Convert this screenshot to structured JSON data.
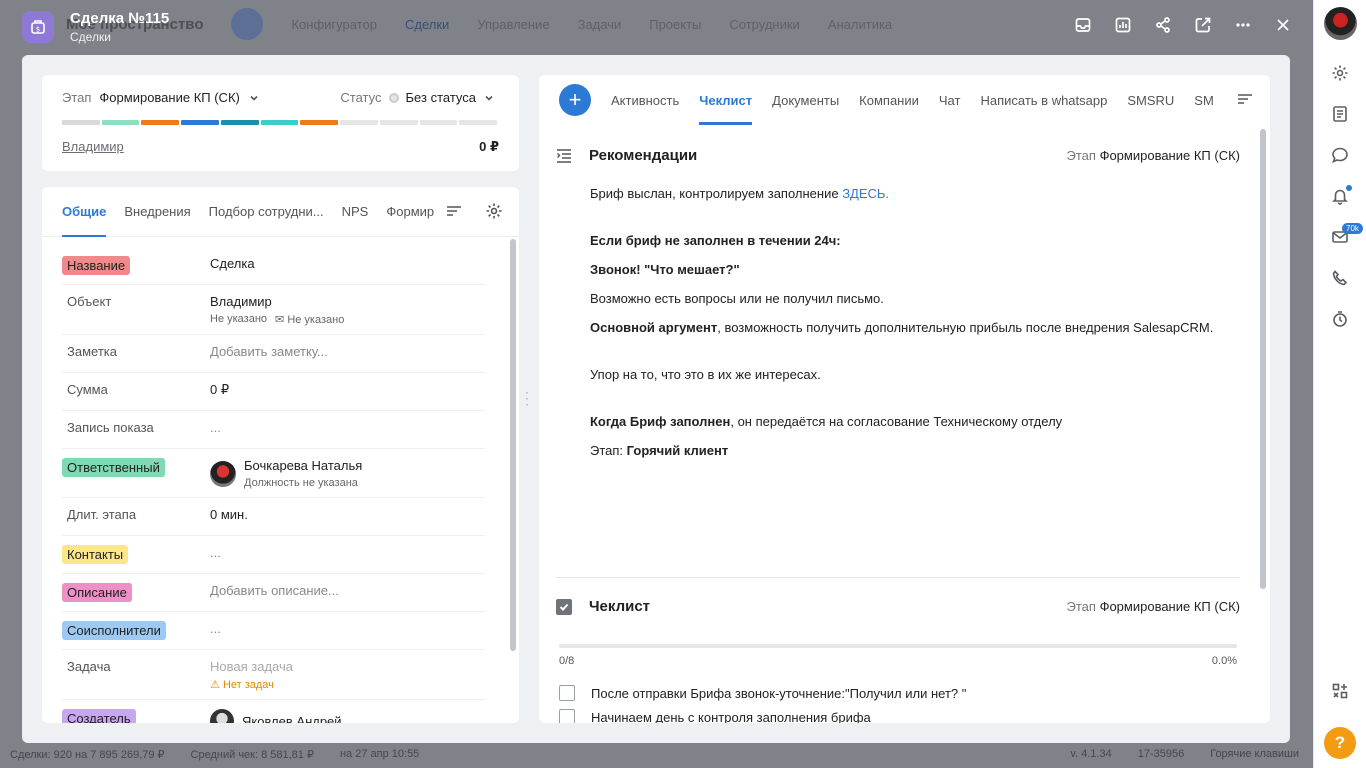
{
  "background": {
    "title": "Моё пространство",
    "nav": [
      "Конфигуратор",
      "Сделки",
      "Управление",
      "Задачи",
      "Проекты",
      "Сотрудники",
      "Аналитика"
    ],
    "footer_left": [
      "Сделки: 920 на 7 895 269,79 ₽",
      "Средний чек: 8 581,81 ₽",
      "на 27 апр 10:55"
    ],
    "footer_right": [
      "v. 4.1.34",
      "17-35956",
      "Горячие клавиши"
    ]
  },
  "header": {
    "title": "Сделка №115",
    "subtitle": "Сделки",
    "tools": [
      "inbox-icon",
      "chart-icon",
      "share-icon",
      "open-external-icon",
      "more-icon",
      "close-icon"
    ]
  },
  "stage_card": {
    "stage_label": "Этап",
    "stage_value": "Формирование КП (СК)",
    "status_label": "Статус",
    "status_value": "Без статуса",
    "progress_colors": [
      "#d9d9d9",
      "#8ce0bf",
      "#f07a1a",
      "#2d7ad6",
      "#1a8fa6",
      "#3dcdc9",
      "#f07a1a",
      "#e5e5e5",
      "#e5e5e5",
      "#e5e5e5",
      "#e5e5e5"
    ],
    "owner": "Владимир",
    "sum": "0 ₽"
  },
  "fields": {
    "tabs": [
      "Общие",
      "Внедрения",
      "Подбор сотрудни...",
      "NPS",
      "Формир"
    ],
    "rows": {
      "name": {
        "label": "Название",
        "value": "Сделка",
        "tag_color": "#f08a8a"
      },
      "object": {
        "label": "Объект",
        "value": "Владимир",
        "sub1": "Не указано",
        "sub2": "Не указано"
      },
      "note": {
        "label": "Заметка",
        "value": "Добавить заметку..."
      },
      "sum": {
        "label": "Сумма",
        "value": "0 ₽"
      },
      "record": {
        "label": "Запись показа",
        "value": "..."
      },
      "responsible": {
        "label": "Ответственный",
        "value": "Бочкарева Наталья",
        "sub": "Должность не указана",
        "tag_color": "#7fd9b3"
      },
      "duration": {
        "label": "Длит. этапа",
        "value": "0 мин."
      },
      "contacts": {
        "label": "Контакты",
        "value": "...",
        "tag_color": "#fce68a"
      },
      "description": {
        "label": "Описание",
        "value": "Добавить описание...",
        "tag_color": "#ee8fc6"
      },
      "coexec": {
        "label": "Соисполнители",
        "value": "...",
        "tag_color": "#9ec9f2"
      },
      "task": {
        "label": "Задача",
        "value": "Новая задача",
        "warn": "Нет задач"
      },
      "creator": {
        "label": "Создатель",
        "value": "Яковлев Андрей",
        "tag_color": "#c9a7f0"
      }
    }
  },
  "right": {
    "tabs": [
      "Активность",
      "Чеклист",
      "Документы",
      "Компании",
      "Чат",
      "Написать в whatsapp",
      "SMSRU",
      "SM"
    ],
    "recommendations": {
      "title": "Рекомендации",
      "stage_label": "Этап",
      "stage_value": "Формирование КП (СК)",
      "p1": "Бриф выслан,  контролируем заполнение ",
      "p1_link": "ЗДЕСЬ.",
      "p2": "Если бриф не заполнен в течении 24ч:",
      "p3": "Звонок! \"Что мешает?\"",
      "p4": "Возможно есть вопросы или не получил письмо.",
      "p5_bold": "Основной аргумент",
      "p5": ", возможность получить дополнительную прибыль после внедрения SalesapCRM.",
      "p6": "Упор на то, что это в их же интересах.",
      "p7_bold": "Когда Бриф заполнен",
      "p7": ", он передаётся на согласование Техническому отделу",
      "p8": "Этап: ",
      "p8_bold": "Горячий клиент"
    },
    "checklist": {
      "title": "Чеклист",
      "stage_label": "Этап",
      "stage_value": "Формирование КП (СК)",
      "count": "0/8",
      "percent": "0.0%",
      "progress": 0,
      "items": [
        "После отправки Брифа звонок-уточнение:\"Получил или нет? \"",
        "Начинаем день с контроля заполнения брифа"
      ]
    }
  },
  "sidebar": {
    "icons": [
      "settings-icon",
      "document-icon",
      "chat-icon",
      "bell-icon",
      "mail-icon",
      "phone-icon",
      "timer-icon",
      "apps-icon"
    ],
    "mail_badge": "70k",
    "help": "?"
  }
}
